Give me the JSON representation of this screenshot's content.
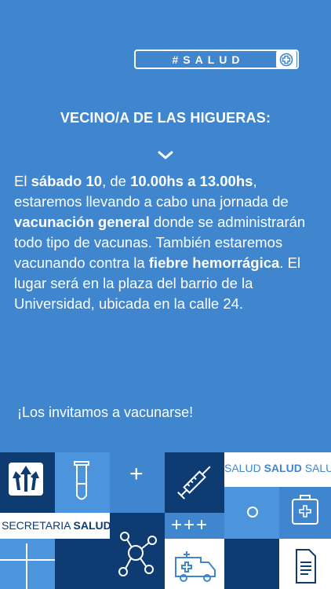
{
  "tag": {
    "label": "#SALUD",
    "icon": "medical-plus-icon"
  },
  "headline": "VECINO/A DE LAS HIGUERAS:",
  "body": {
    "p1": "El ",
    "b1": "sábado 10",
    "p2": ", de ",
    "b2": "10.00hs a 13.00hs",
    "p3": ", estaremos llevando a cabo una jornada de ",
    "b3": "vacunación general",
    "p4": " donde se administrarán todo tipo de vacunas. También estaremos vacunando contra la ",
    "b4": "fiebre hemorrágica",
    "p5": ". El lugar será en la plaza del barrio de la Universidad, ubicada en la calle 24."
  },
  "invite": "¡Los invitamos a vacunarse!",
  "footer": {
    "salud_strip": {
      "a": "SALUD ",
      "b": "SALUD",
      "c": " SALUD"
    },
    "secretaria": {
      "a": "SECRETARIA ",
      "b": "SALUD"
    },
    "plus_triple": "+++",
    "plus_single": "+"
  },
  "colors": {
    "background": "#3f86cf",
    "navy": "#0f3b73",
    "white": "#ffffff"
  }
}
